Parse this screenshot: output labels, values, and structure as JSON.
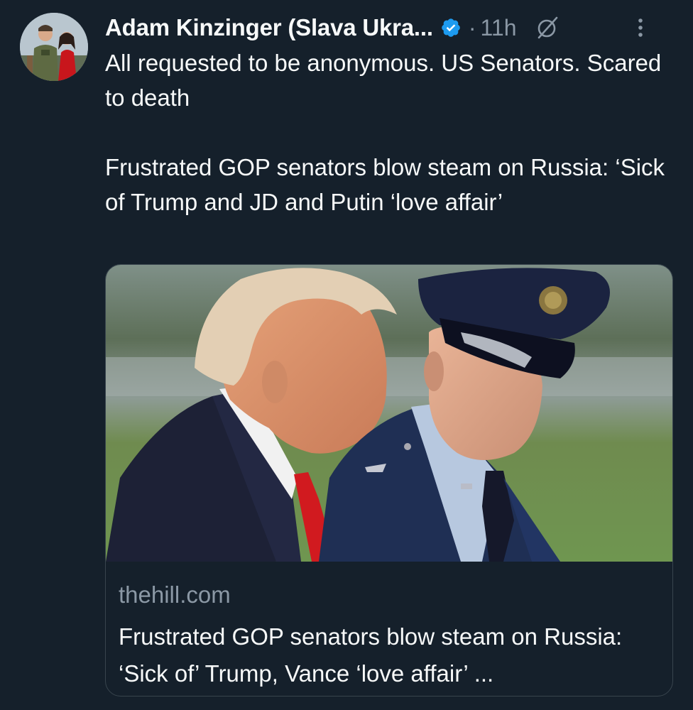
{
  "tweet": {
    "author_name": "Adam Kinzinger (Slava Ukra...",
    "separator": "·",
    "time": "11h",
    "text_line1": "All requested to be anonymous.  US Senators. Scared to death",
    "text_line2": "Frustrated GOP senators blow steam on Russia: ‘Sick of Trump and JD and Putin ‘love affair’"
  },
  "card": {
    "domain": "thehill.com",
    "title": "Frustrated GOP senators blow steam on Russia: ‘Sick of’ Trump, Vance ‘love affair’ ..."
  },
  "icons": {
    "verified": "verified-badge-icon",
    "grok": "grok-icon",
    "more": "more-vertical-icon"
  },
  "colors": {
    "background": "#15202b",
    "text_primary": "#f7f9f9",
    "text_secondary": "#8b98a5",
    "verified_blue": "#1d9bf0",
    "card_border": "#38444d"
  }
}
